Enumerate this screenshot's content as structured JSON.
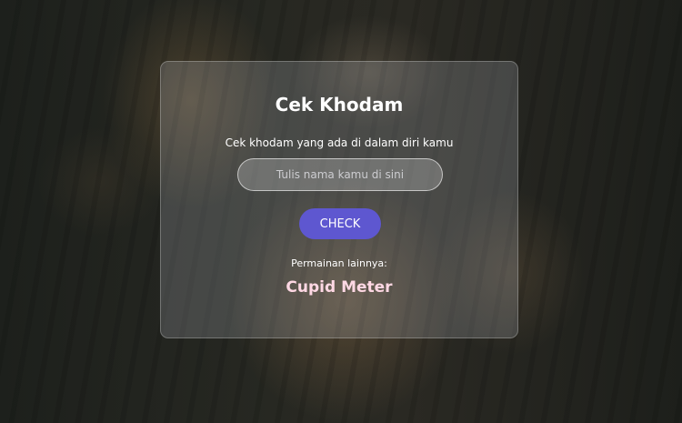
{
  "card": {
    "title": "Cek Khodam",
    "subtitle": "Cek khodam yang ada di dalam diri kamu",
    "input": {
      "value": "",
      "placeholder": "Tulis nama kamu di sini"
    },
    "check_label": "CHECK",
    "others_label": "Permainan lainnya:",
    "other_game_link": "Cupid Meter"
  },
  "colors": {
    "button": "#5e57d0",
    "link": "#ffd8e4",
    "text": "#ffffff"
  }
}
